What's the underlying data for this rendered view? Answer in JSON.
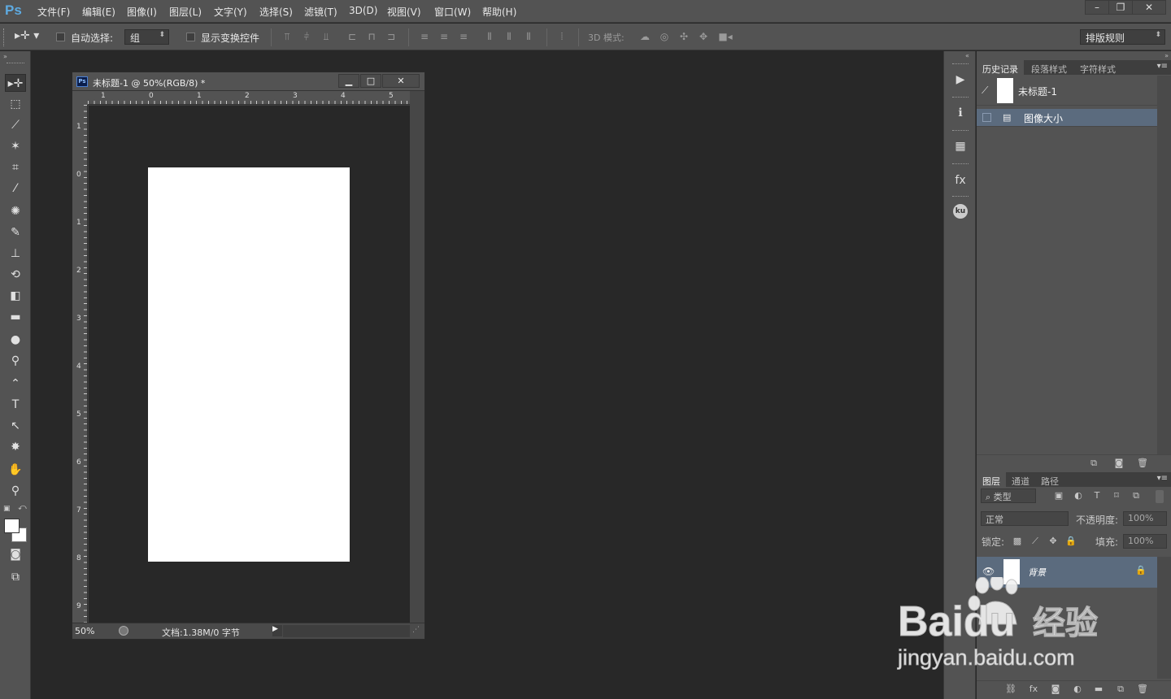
{
  "app": {
    "logo": "Ps"
  },
  "menubar": {
    "items": [
      "文件(F)",
      "编辑(E)",
      "图像(I)",
      "图层(L)",
      "文字(Y)",
      "选择(S)",
      "滤镜(T)",
      "3D(D)",
      "视图(V)",
      "窗口(W)",
      "帮助(H)"
    ],
    "window_controls": {
      "minimize": "–",
      "restore": "❐",
      "close": "✕"
    }
  },
  "options_bar": {
    "auto_select_label": "自动选择:",
    "auto_select_checked": false,
    "auto_select_value": "组",
    "show_transform_label": "显示变换控件",
    "show_transform_checked": false,
    "mode_3d_label": "3D 模式:",
    "workspace_value": "排版规则"
  },
  "document": {
    "title": "未标题-1 @ 50%(RGB/8) *",
    "zoom": "50%",
    "doc_info": "文档:1.38M/0 字节",
    "ruler_top": [
      "1",
      "0",
      "1",
      "2",
      "3",
      "4",
      "5"
    ],
    "ruler_left": [
      "1",
      "0",
      "1",
      "2",
      "3",
      "4",
      "5",
      "6",
      "7",
      "8",
      "9"
    ]
  },
  "history_panel": {
    "tabs": [
      "历史记录",
      "段落样式",
      "字符样式"
    ],
    "snapshot": "未标题-1",
    "states": [
      "图像大小"
    ]
  },
  "layers_panel": {
    "tabs": [
      "图层",
      "通道",
      "路径"
    ],
    "filter_kind": "类型",
    "blend_mode": "正常",
    "opacity_label": "不透明度:",
    "opacity_value": "100%",
    "lock_label": "锁定:",
    "fill_label": "填充:",
    "fill_value": "100%",
    "layers": [
      {
        "name": "背景",
        "locked": true,
        "visible": true
      }
    ]
  },
  "watermark": {
    "brand": "Baidu",
    "service": "经验",
    "url": "jingyan.baidu.com"
  },
  "colors": {
    "accent_selected": "#5b6b7e",
    "ps_blue": "#5eaae0",
    "bg_dark": "#282828",
    "panel": "#535353"
  }
}
